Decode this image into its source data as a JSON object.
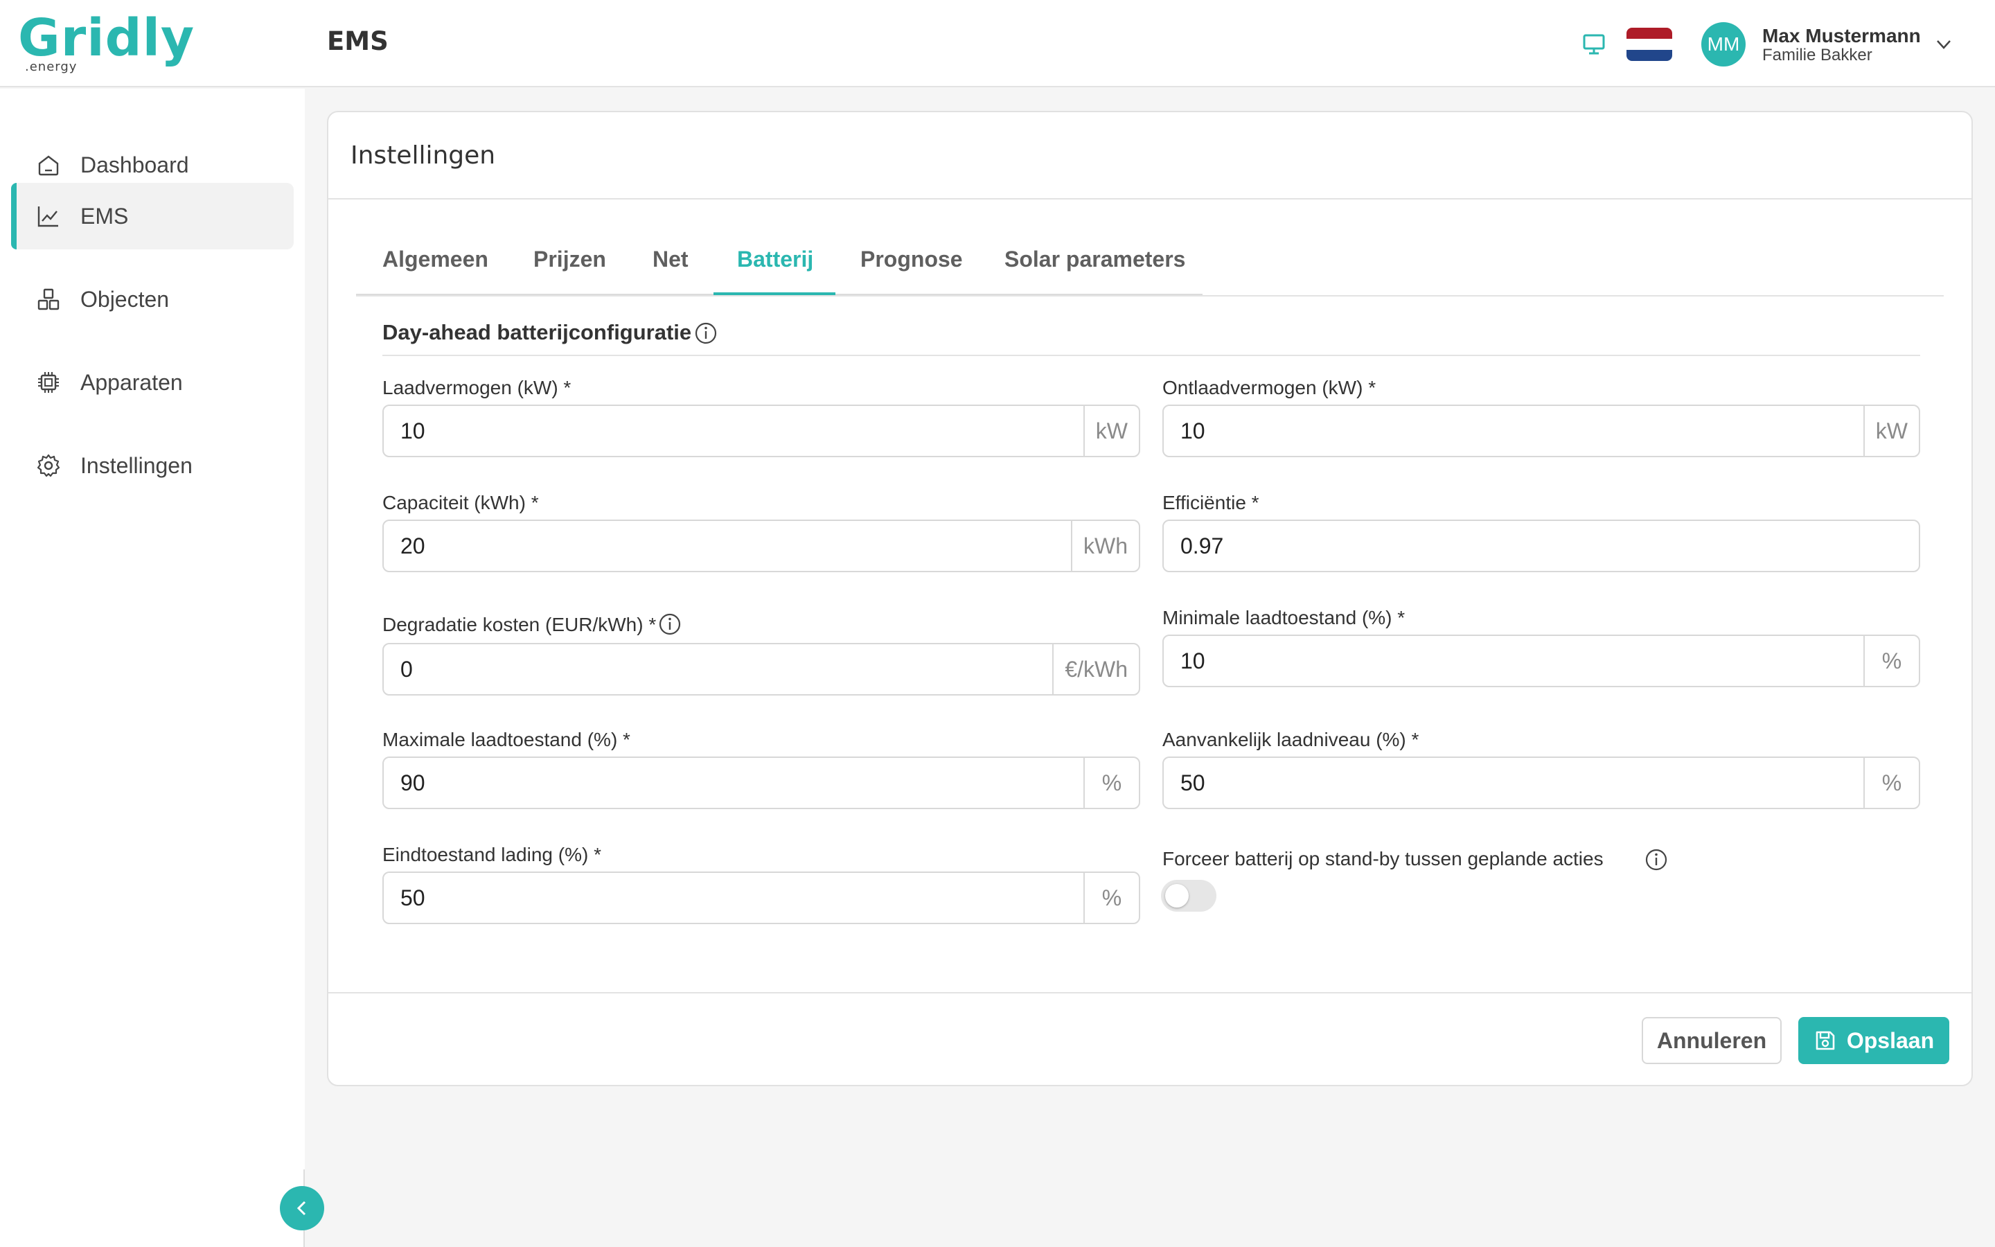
{
  "brand": {
    "name": "Gridly",
    "sub": ".energy"
  },
  "header": {
    "title": "EMS",
    "user": {
      "initials": "MM",
      "name": "Max Mustermann",
      "family": "Familie Bakker"
    }
  },
  "sidebar": {
    "items": [
      {
        "label": "Dashboard",
        "icon": "home-icon"
      },
      {
        "label": "EMS",
        "icon": "chart-line-icon"
      },
      {
        "label": "Objecten",
        "icon": "boxes-icon"
      },
      {
        "label": "Apparaten",
        "icon": "chip-icon"
      },
      {
        "label": "Instellingen",
        "icon": "gear-icon"
      }
    ],
    "active_index": 1
  },
  "settings": {
    "title": "Instellingen",
    "tabs": [
      "Algemeen",
      "Prijzen",
      "Net",
      "Batterij",
      "Prognose",
      "Solar parameters"
    ],
    "active_tab": "Batterij",
    "section_title": "Day-ahead batterijconfiguratie",
    "fields": {
      "charge_power": {
        "label": "Laadvermogen (kW) *",
        "value": "10",
        "unit": "kW"
      },
      "discharge_power": {
        "label": "Ontlaadvermogen (kW) *",
        "value": "10",
        "unit": "kW"
      },
      "capacity": {
        "label": "Capaciteit (kWh) *",
        "value": "20",
        "unit": "kWh"
      },
      "efficiency": {
        "label": "Efficiëntie *",
        "value": "0.97"
      },
      "degradation": {
        "label": "Degradatie kosten (EUR/kWh) *",
        "value": "0",
        "unit": "€/kWh"
      },
      "min_soc": {
        "label": "Minimale laadtoestand (%) *",
        "value": "10",
        "unit": "%"
      },
      "max_soc": {
        "label": "Maximale laadtoestand (%) *",
        "value": "90",
        "unit": "%"
      },
      "initial_soc": {
        "label": "Aanvankelijk laadniveau (%) *",
        "value": "50",
        "unit": "%"
      },
      "final_soc": {
        "label": "Eindtoestand lading (%) *",
        "value": "50",
        "unit": "%"
      },
      "force_standby": {
        "label": "Forceer batterij op stand-by tussen geplande acties",
        "value": false
      }
    },
    "buttons": {
      "cancel": "Annuleren",
      "save": "Opslaan"
    }
  },
  "colors": {
    "accent": "#2bb7b0",
    "flag": [
      "#ae1c28",
      "#ffffff",
      "#21468b"
    ]
  }
}
